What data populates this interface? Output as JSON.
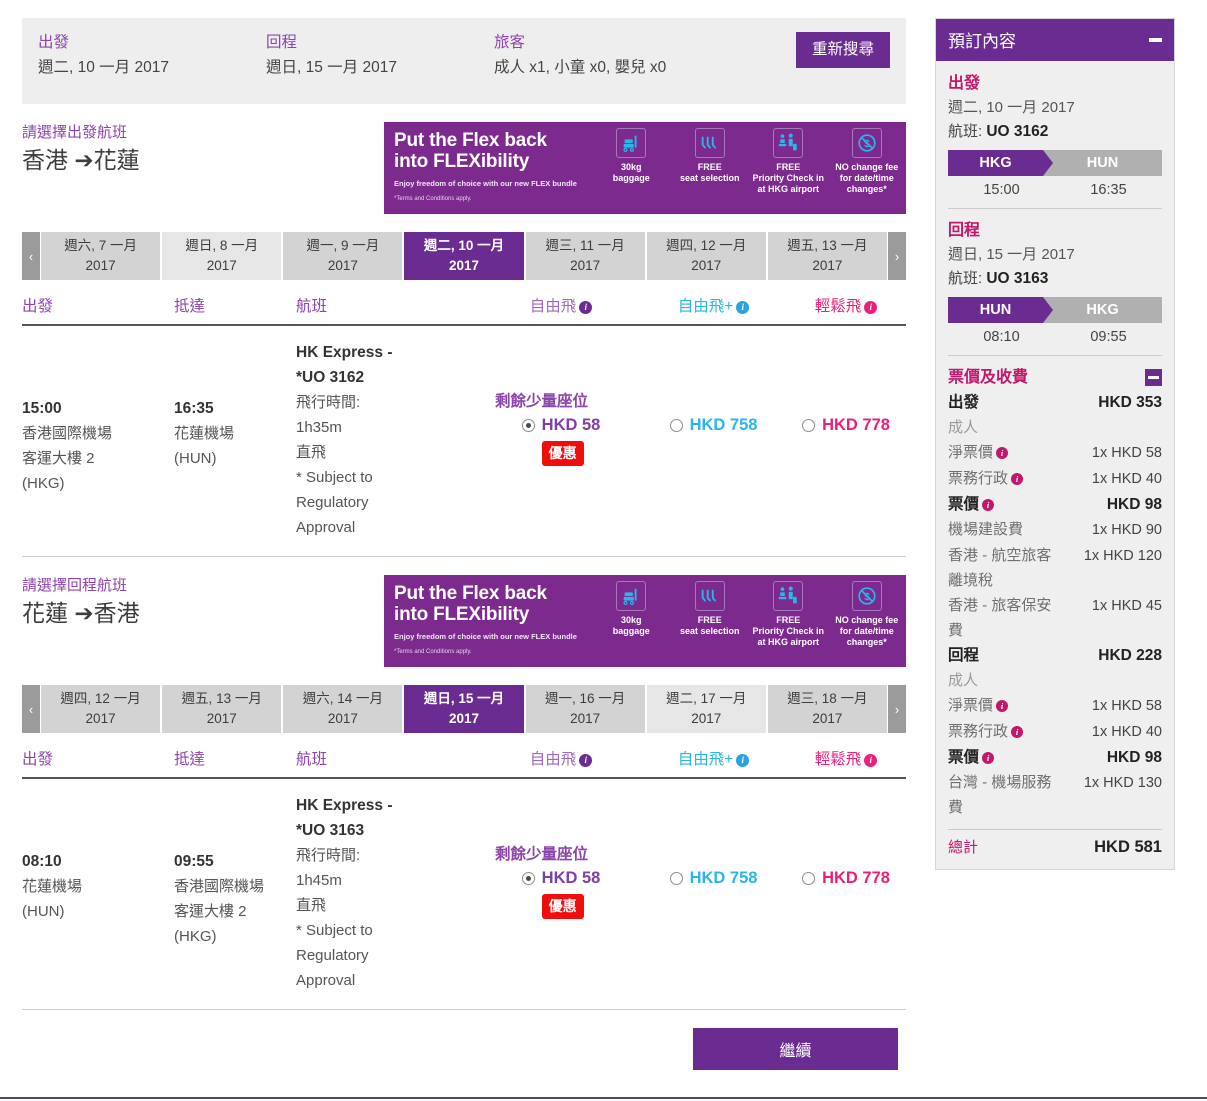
{
  "search_bar": {
    "depart_label": "出發",
    "depart_value": "週二, 10 一月 2017",
    "return_label": "回程",
    "return_value": "週日, 15 一月 2017",
    "pax_label": "旅客",
    "pax_value": "成人 x1, 小童 x0, 嬰兒 x0",
    "research_button": "重新搜尋"
  },
  "banner": {
    "headline_line1": "Put the Flex back",
    "headline_line2": "into FLEXibility",
    "subline": "Enjoy freedom of choice with our new FLEX bundle",
    "terms": "*Terms and Conditions apply.",
    "items": [
      {
        "caption_line1": "30kg",
        "caption_line2": "baggage",
        "caption_line3": "",
        "icon": "baggage-icon"
      },
      {
        "caption_line1": "FREE",
        "caption_line2": "seat selection",
        "caption_line3": "",
        "icon": "seat-icon"
      },
      {
        "caption_line1": "FREE",
        "caption_line2": "Priority Check in",
        "caption_line3": "at HKG airport",
        "icon": "priority-checkin-icon"
      },
      {
        "caption_line1": "NO change fee",
        "caption_line2": "for date/time",
        "caption_line3": "changes*",
        "icon": "no-change-fee-icon"
      }
    ]
  },
  "columns": {
    "depart": "出發",
    "arrive": "抵達",
    "flight": "航班",
    "fare1": "自由飛",
    "fare2": "自由飛+",
    "fare3": "輕鬆飛"
  },
  "outbound": {
    "select_prompt": "請選擇出發航班",
    "route": "香港 ➔花蓮",
    "route_from": "香港",
    "route_to": "花蓮",
    "dates": [
      {
        "line1": "週六, 7 一月",
        "line2": "2017",
        "selected": false
      },
      {
        "line1": "週日, 8 一月",
        "line2": "2017",
        "selected": false
      },
      {
        "line1": "週一, 9 一月",
        "line2": "2017",
        "selected": false
      },
      {
        "line1": "週二, 10 一月",
        "line2": "2017",
        "selected": true
      },
      {
        "line1": "週三, 11 一月",
        "line2": "2017",
        "selected": false
      },
      {
        "line1": "週四, 12 一月",
        "line2": "2017",
        "selected": false
      },
      {
        "line1": "週五, 13 一月",
        "line2": "2017",
        "selected": false
      }
    ],
    "flight": {
      "depart_time": "15:00",
      "depart_place_l1": "香港國際機場",
      "depart_place_l2": "客運大樓 2",
      "depart_place_l3": "(HKG)",
      "arrive_time": "16:35",
      "arrive_place_l1": "花蓮機場",
      "arrive_place_l2": "(HUN)",
      "arrive_place_l3": "",
      "carrier_l1": "HK Express -",
      "carrier_l2": "*UO 3162",
      "duration_label": "飛行時間:",
      "duration_value": "1h35m",
      "stops": "直飛",
      "note_l1": "* Subject to",
      "note_l2": "Regulatory",
      "note_l3": "Approval",
      "availability": "剩餘少量座位",
      "fare1_price": "HKD 58",
      "fare1_promo": "優惠",
      "fare1_selected": true,
      "fare2_price": "HKD 758",
      "fare2_selected": false,
      "fare3_price": "HKD 778",
      "fare3_selected": false
    }
  },
  "inbound": {
    "select_prompt": "請選擇回程航班",
    "route": "花蓮 ➔香港",
    "dates": [
      {
        "line1": "週四, 12 一月",
        "line2": "2017",
        "selected": false
      },
      {
        "line1": "週五, 13 一月",
        "line2": "2017",
        "selected": false
      },
      {
        "line1": "週六, 14 一月",
        "line2": "2017",
        "selected": false
      },
      {
        "line1": "週日, 15 一月",
        "line2": "2017",
        "selected": true
      },
      {
        "line1": "週一, 16 一月",
        "line2": "2017",
        "selected": false
      },
      {
        "line1": "週二, 17 一月",
        "line2": "2017",
        "selected": false
      },
      {
        "line1": "週三, 18 一月",
        "line2": "2017",
        "selected": false
      }
    ],
    "flight": {
      "depart_time": "08:10",
      "depart_place_l1": "花蓮機場",
      "depart_place_l2": "(HUN)",
      "depart_place_l3": "",
      "arrive_time": "09:55",
      "arrive_place_l1": "香港國際機場",
      "arrive_place_l2": "客運大樓 2",
      "arrive_place_l3": "(HKG)",
      "carrier_l1": "HK Express -",
      "carrier_l2": "*UO 3163",
      "duration_label": "飛行時間:",
      "duration_value": "1h45m",
      "stops": "直飛",
      "note_l1": "* Subject to",
      "note_l2": "Regulatory",
      "note_l3": "Approval",
      "availability": "剩餘少量座位",
      "fare1_price": "HKD 58",
      "fare1_promo": "優惠",
      "fare1_selected": true,
      "fare2_price": "HKD 758",
      "fare2_selected": false,
      "fare3_price": "HKD 778",
      "fare3_selected": false
    }
  },
  "continue_button": "繼續",
  "sidebar": {
    "title": "預訂內容",
    "outbound": {
      "heading": "出發",
      "date": "週二, 10 一月 2017",
      "flight_label": "航班: ",
      "flight_number": "UO 3162",
      "from": "HKG",
      "to": "HUN",
      "depart_time": "15:00",
      "arrive_time": "16:35"
    },
    "inbound": {
      "heading": "回程",
      "date": "週日, 15 一月 2017",
      "flight_label": "航班: ",
      "flight_number": "UO 3163",
      "from": "HUN",
      "to": "HKG",
      "depart_time": "08:10",
      "arrive_time": "09:55"
    },
    "fares": {
      "heading": "票價及收費",
      "outbound_label": "出發",
      "outbound_total": "HKD 353",
      "outbound_pax": "成人",
      "outbound_rows": [
        {
          "key": "淨票價",
          "info": true,
          "value": "1x HKD 58",
          "strong": false
        },
        {
          "key": "票務行政",
          "info": true,
          "value": "1x HKD 40",
          "strong": false
        },
        {
          "key": "票價",
          "info": true,
          "value": "HKD 98",
          "strong": true
        },
        {
          "key": "機場建設費",
          "info": false,
          "value": "1x HKD 90",
          "strong": false
        },
        {
          "key": "香港 - 航空旅客離境稅",
          "info": false,
          "value": "1x HKD 120",
          "strong": false
        },
        {
          "key": "香港 - 旅客保安費",
          "info": false,
          "value": "1x HKD 45",
          "strong": false
        }
      ],
      "inbound_label": "回程",
      "inbound_total": "HKD 228",
      "inbound_pax": "成人",
      "inbound_rows": [
        {
          "key": "淨票價",
          "info": true,
          "value": "1x HKD 58",
          "strong": false
        },
        {
          "key": "票務行政",
          "info": true,
          "value": "1x HKD 40",
          "strong": false
        },
        {
          "key": "票價",
          "info": true,
          "value": "HKD 98",
          "strong": true
        },
        {
          "key": "台灣 - 機場服務費",
          "info": false,
          "value": "1x HKD 130",
          "strong": false
        }
      ],
      "total_label": "總計",
      "total_value": "HKD 581"
    }
  },
  "colors": {
    "brand_purple": "#6b2c91",
    "banner_purple": "#7d2a8f",
    "accent_pink": "#c2186c",
    "fare1": "#7e3fa8",
    "fare2": "#29b6e8",
    "fare3": "#ed1e79",
    "promo_red": "#f00d0d",
    "icon_cyan": "#29b6e8"
  }
}
